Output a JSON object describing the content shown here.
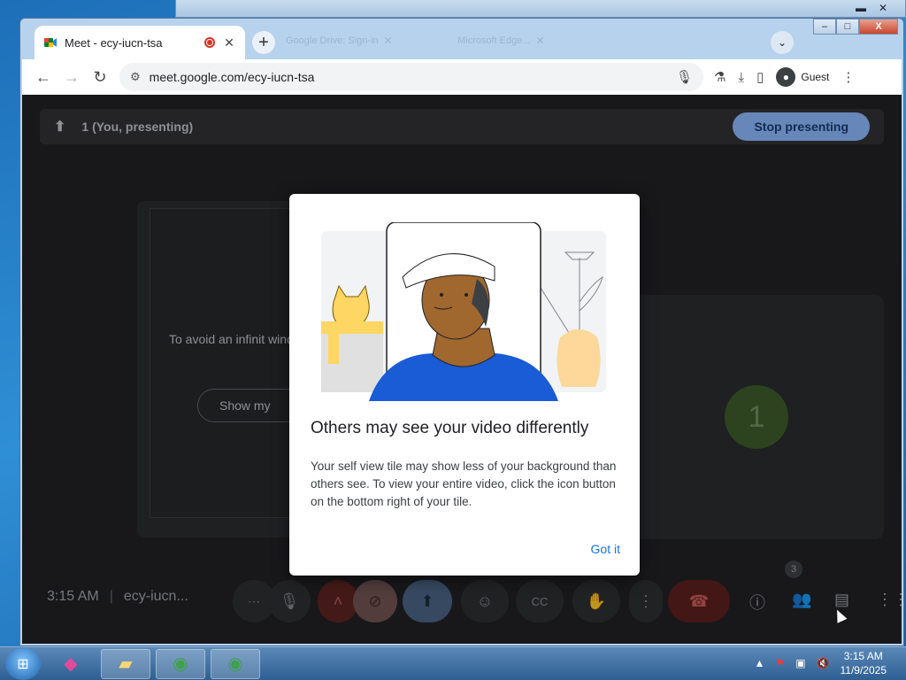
{
  "browser": {
    "tab": {
      "title": "Meet - ecy-iucn-tsa",
      "favicon": "google-meet-icon",
      "recording_indicator": "record-icon",
      "close_icon": "close-icon"
    },
    "ghost_tabs": [
      "Google Drive: Sign-in",
      "Microsoft Edge..."
    ],
    "new_tab_icon": "plus-icon",
    "tab_search_icon": "chevron-down-icon",
    "window_controls": {
      "minimize": "–",
      "maximize": "□",
      "close": "X"
    },
    "address": {
      "url": "meet.google.com/ecy-iucn-tsa"
    },
    "profile": {
      "label": "Guest"
    }
  },
  "meet": {
    "presentation_bar": {
      "label": "1 (You, presenting)",
      "stop_button": "Stop presenting"
    },
    "left_tile": {
      "message": "To avoid an infinit window. S",
      "button": "Show my"
    },
    "right_tile": {
      "avatar_letter": "1",
      "number": "1"
    },
    "bottom_bar": {
      "time": "3:15 AM",
      "meeting_code": "ecy-iucn...",
      "people_badge": "3"
    }
  },
  "dialog": {
    "title": "Others may see your video differently",
    "body": "Your self view tile may show less of your background than others see. To view your entire video, click the icon button on the bottom right of your tile.",
    "action": "Got it"
  },
  "taskbar": {
    "time": "3:15 AM",
    "date": "11/9/2025",
    "apps": [
      "app-icon",
      "file-explorer-icon",
      "chrome-icon",
      "chrome-icon"
    ]
  }
}
